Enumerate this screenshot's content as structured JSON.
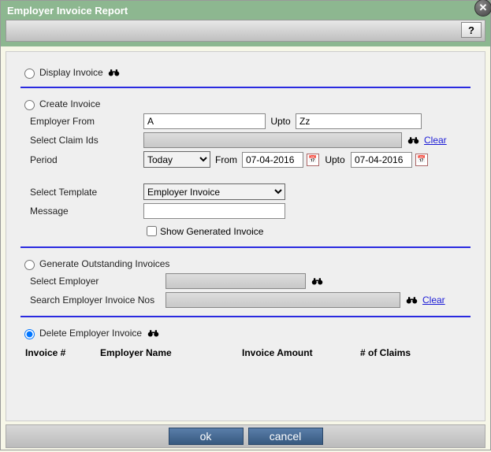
{
  "window": {
    "title": "Employer Invoice Report"
  },
  "toolbar": {
    "help": "?"
  },
  "options": {
    "display": "Display Invoice",
    "create": "Create Invoice",
    "outstanding": "Generate Outstanding Invoices",
    "delete": "Delete Employer Invoice"
  },
  "create": {
    "employerFrom_label": "Employer From",
    "employerFrom_value": "A",
    "upto_label": "Upto",
    "upto_value": "Zz",
    "claimIds_label": "Select Claim Ids",
    "clear": "Clear",
    "period_label": "Period",
    "period_value": "Today",
    "from_label": "From",
    "from_value": "07-04-2016",
    "periodUpto_label": "Upto",
    "periodUpto_value": "07-04-2016",
    "template_label": "Select Template",
    "template_value": "Employer Invoice",
    "message_label": "Message",
    "message_value": "",
    "showGen_label": "Show Generated Invoice"
  },
  "outstanding": {
    "selectEmployer_label": "Select Employer",
    "searchInvNos_label": "Search Employer Invoice Nos",
    "clear": "Clear"
  },
  "delete": {
    "cols": {
      "invoiceNo": "Invoice #",
      "employerName": "Employer Name",
      "invoiceAmount": "Invoice Amount",
      "numClaims": "# of Claims"
    }
  },
  "footer": {
    "ok": "ok",
    "cancel": "cancel"
  }
}
